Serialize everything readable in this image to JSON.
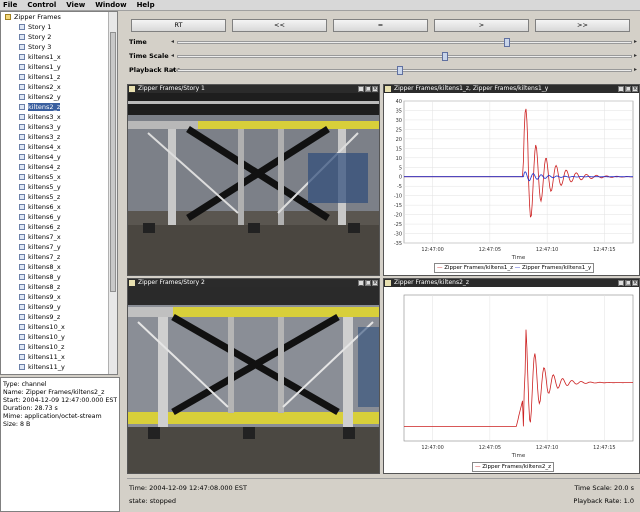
{
  "menu": [
    "File",
    "Control",
    "View",
    "Window",
    "Help"
  ],
  "tree": {
    "root": "Zipper Frames",
    "items": [
      "Story 1",
      "Story 2",
      "Story 3",
      "kiltens1_x",
      "kiltens1_y",
      "kiltens1_z",
      "kiltens2_x",
      "kiltens2_y",
      "kiltens2_z",
      "kiltens3_x",
      "kiltens3_y",
      "kiltens3_z",
      "kiltens4_x",
      "kiltens4_y",
      "kiltens4_z",
      "kiltens5_x",
      "kiltens5_y",
      "kiltens5_z",
      "kiltens6_x",
      "kiltens6_y",
      "kiltens6_z",
      "kiltens7_x",
      "kiltens7_y",
      "kiltens7_z",
      "kiltens8_x",
      "kiltens8_y",
      "kiltens8_z",
      "kiltens9_x",
      "kiltens9_y",
      "kiltens9_z",
      "kiltens10_x",
      "kiltens10_y",
      "kiltens10_z",
      "kiltens11_x",
      "kiltens11_y"
    ],
    "selected_index": 8
  },
  "info": {
    "type": "Type: channel",
    "name": "Name: Zipper Frames/kiltens2_z",
    "start": "Start: 2004-12-09 12:47:00.000 EST",
    "duration": "Duration: 28.73 s",
    "mime": "Mime: application/octet-stream",
    "size": "Size: 8 B"
  },
  "controls": {
    "buttons": [
      "RT",
      "<<",
      "=",
      ">",
      ">>"
    ],
    "sliders": [
      {
        "label": "Time",
        "value": 0.73
      },
      {
        "label": "Time Scale",
        "value": 0.59
      },
      {
        "label": "Playback Rate",
        "value": 0.49
      }
    ]
  },
  "frames": {
    "video1_title": "Zipper Frames/Story 1",
    "video2_title": "Zipper Frames/Story 2",
    "plot1_title": "Zipper Frames/kiltens1_z, Zipper Frames/kiltens1_y",
    "plot2_title": "Zipper Frames/kiltens2_z"
  },
  "chart_data": [
    {
      "type": "line",
      "xlabel": "Time",
      "x_ticks": [
        "12:47:00",
        "12:47:05",
        "12:47:10",
        "12:47:15"
      ],
      "y_ticks": [
        "40",
        "35",
        "30",
        "25",
        "20",
        "15",
        "10",
        "5",
        "0",
        "-5",
        "-10",
        "-15",
        "-20",
        "-25",
        "-30",
        "-35"
      ],
      "ylim": [
        -35,
        40
      ],
      "series": [
        {
          "name": "Zipper Frames/kiltens1_z",
          "color": "#cc2020"
        },
        {
          "name": "Zipper Frames/kiltens1_y",
          "color": "#2030cc"
        }
      ],
      "grid": true
    },
    {
      "type": "line",
      "xlabel": "Time",
      "x_ticks": [
        "12:47:00",
        "12:47:05",
        "12:47:10",
        "12:47:15"
      ],
      "ylim": [
        -10,
        90
      ],
      "series": [
        {
          "name": "Zipper Frames/kiltens2_z",
          "color": "#cc2020"
        }
      ],
      "grid": true
    }
  ],
  "status": {
    "time": "Time: 2004-12-09 12:47:08.000 EST",
    "time_scale": "Time Scale: 20.0 s",
    "state": "state: stopped",
    "playback_rate": "Playback Rate: 1.0"
  }
}
